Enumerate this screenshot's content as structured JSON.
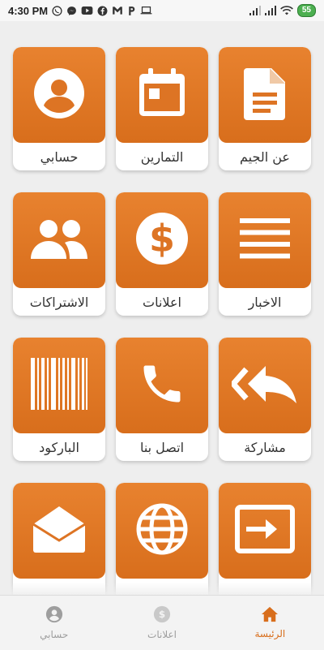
{
  "status_bar": {
    "time": "4:30 PM",
    "battery": "55",
    "left_icons": [
      "whatsapp-icon",
      "messenger-icon",
      "youtube-icon",
      "facebook-icon",
      "gmail-icon",
      "p-app-icon",
      "laptop-icon"
    ],
    "right_icons": [
      "signal-icon",
      "signal-icon",
      "wifi-icon",
      "battery-icon"
    ]
  },
  "tiles": [
    {
      "label": "حسابي",
      "icon": "account-icon"
    },
    {
      "label": "التمارين",
      "icon": "calendar-icon"
    },
    {
      "label": "عن الجيم",
      "icon": "document-icon"
    },
    {
      "label": "الاشتراكات",
      "icon": "people-icon"
    },
    {
      "label": "اعلانات",
      "icon": "dollar-icon"
    },
    {
      "label": "الاخبار",
      "icon": "news-list-icon"
    },
    {
      "label": "الباركود",
      "icon": "barcode-icon"
    },
    {
      "label": "اتصل بنا",
      "icon": "phone-icon"
    },
    {
      "label": "مشاركة",
      "icon": "share-icon"
    },
    {
      "label": "",
      "icon": "mail-open-icon"
    },
    {
      "label": "",
      "icon": "globe-icon"
    },
    {
      "label": "",
      "icon": "logout-icon"
    }
  ],
  "bottom_nav": [
    {
      "label": "الرئيسة",
      "icon": "home-icon",
      "active": true
    },
    {
      "label": "اعلانات",
      "icon": "ads-icon",
      "active": false
    },
    {
      "label": "حسابي",
      "icon": "account-icon",
      "active": false
    }
  ],
  "colors": {
    "accent": "#e27a27",
    "background": "#eeeeee",
    "inactive": "#9e9e9e"
  }
}
